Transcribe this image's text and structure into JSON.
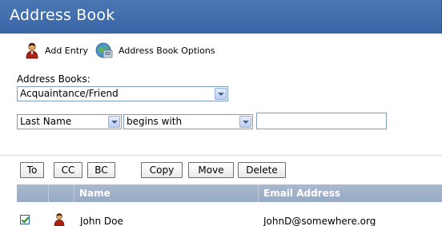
{
  "window": {
    "title": "Address Book"
  },
  "toolbar": {
    "add_entry": {
      "label": "Add Entry",
      "icon": "person-icon"
    },
    "options": {
      "label": "Address Book Options",
      "icon": "address-book-options-icon"
    }
  },
  "address_books": {
    "label": "Address Books:",
    "selected": "Acquaintance/Friend"
  },
  "search": {
    "field_selected": "Last Name",
    "operator_selected": "begins with",
    "value": ""
  },
  "actions": {
    "to": "To",
    "cc": "CC",
    "bc": "BC",
    "copy": "Copy",
    "move": "Move",
    "delete": "Delete"
  },
  "table": {
    "columns": [
      "Name",
      "Email Address"
    ],
    "rows": [
      {
        "checked": true,
        "name": "John Doe",
        "email": "JohnD@somewhere.org"
      }
    ]
  },
  "colors": {
    "title_bar": "#4a76b3",
    "header": "#a9b9cf"
  }
}
